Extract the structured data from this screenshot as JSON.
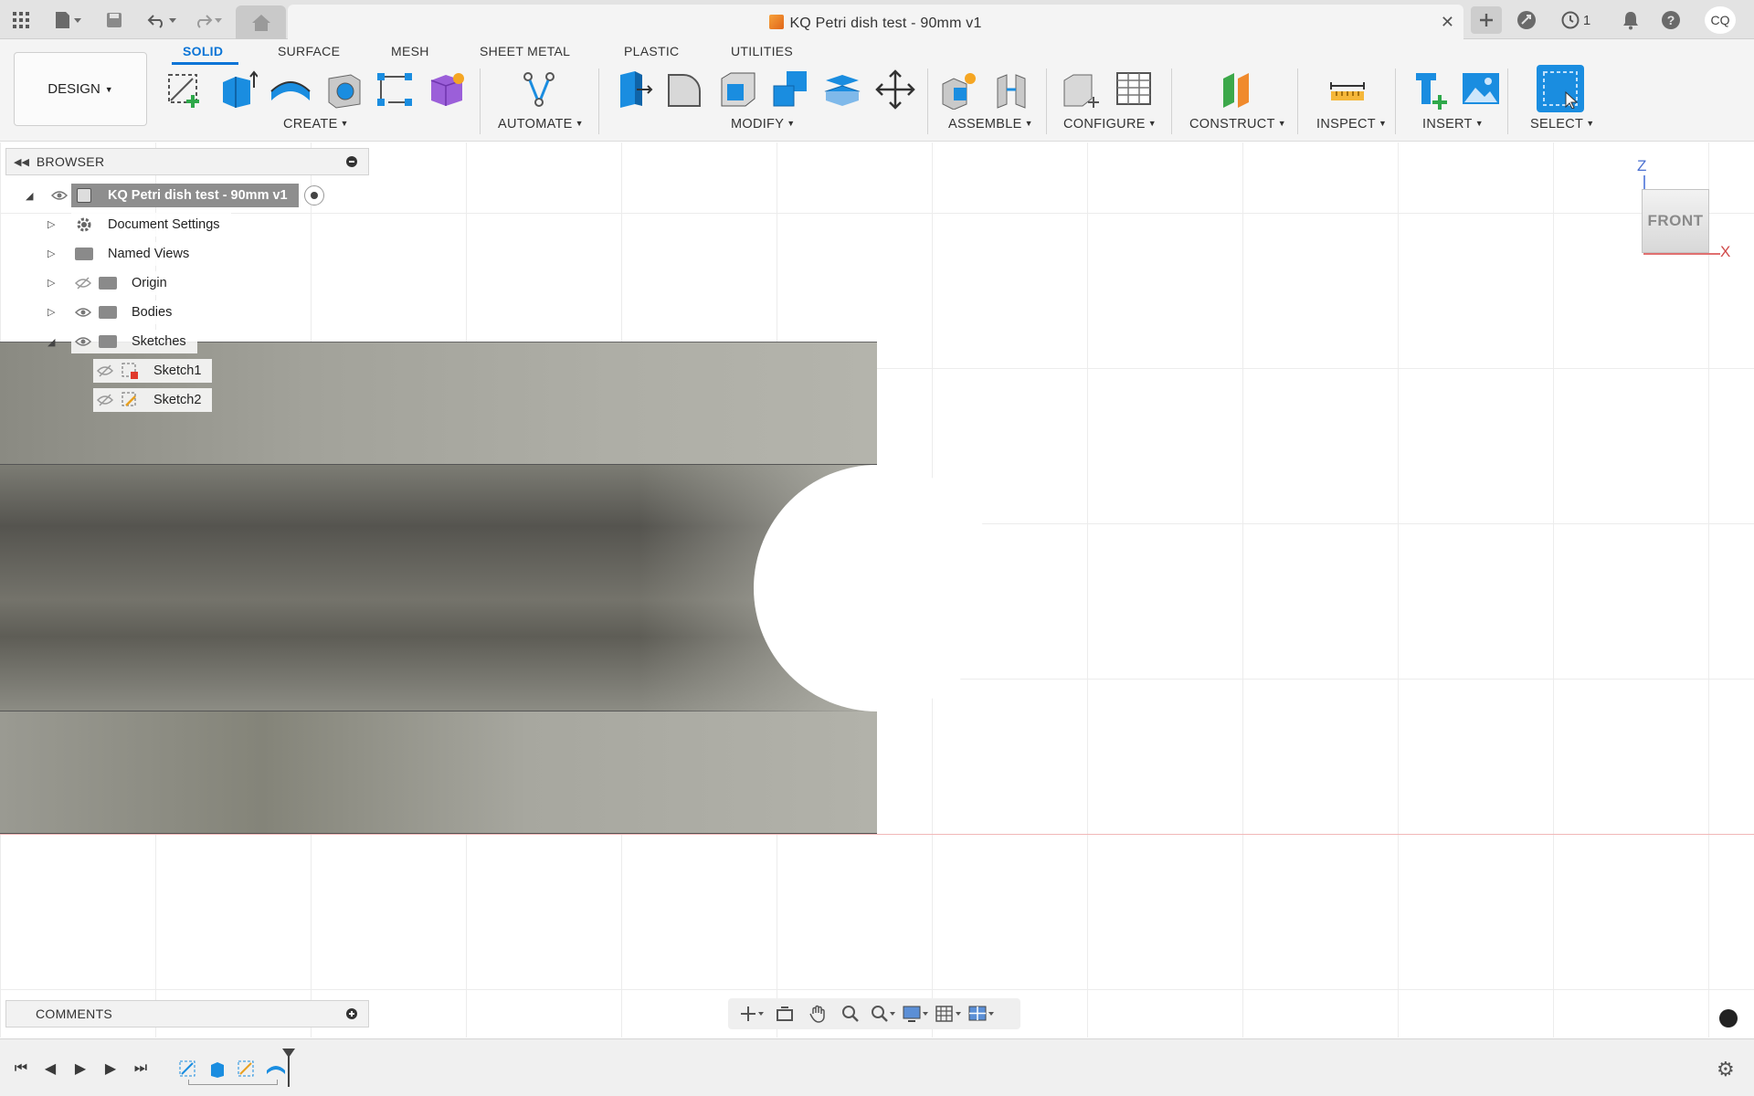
{
  "window": {
    "document_title": "KQ Petri dish test - 90mm v1",
    "jobs_count": "1",
    "user_initials": "CQ"
  },
  "ribbon": {
    "workspace_button": "DESIGN",
    "tabs": [
      "SOLID",
      "SURFACE",
      "MESH",
      "SHEET METAL",
      "PLASTIC",
      "UTILITIES"
    ],
    "active_tab": "SOLID",
    "groups": [
      "CREATE",
      "AUTOMATE",
      "MODIFY",
      "ASSEMBLE",
      "CONFIGURE",
      "CONSTRUCT",
      "INSPECT",
      "INSERT",
      "SELECT"
    ]
  },
  "browser": {
    "title": "BROWSER",
    "root": "KQ Petri dish test - 90mm v1",
    "items": [
      "Document Settings",
      "Named Views",
      "Origin",
      "Bodies",
      "Sketches"
    ],
    "sketches": [
      "Sketch1",
      "Sketch2"
    ]
  },
  "viewcube": {
    "face": "FRONT",
    "axis_z": "Z",
    "axis_x": "X"
  },
  "comments": {
    "title": "COMMENTS"
  },
  "colors": {
    "accent": "#0a74d6",
    "select_blue": "#1a8de0"
  },
  "icons": [
    "apps-grid-icon",
    "file-icon",
    "save-icon",
    "undo-icon",
    "redo-icon",
    "home-icon",
    "close-icon",
    "plus-icon",
    "extensions-icon",
    "jobs-icon",
    "bell-icon",
    "help-icon"
  ]
}
